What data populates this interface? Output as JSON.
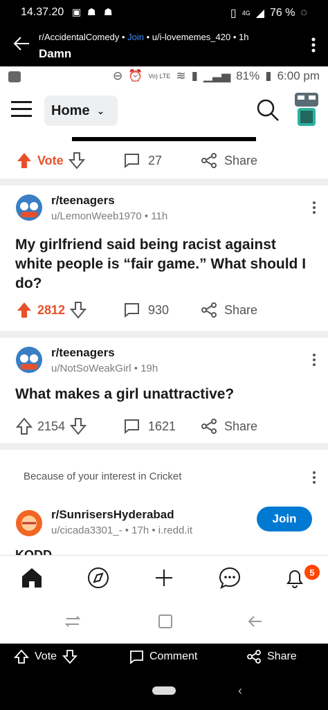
{
  "outer_status": {
    "time": "14.37.20",
    "network": "4G",
    "battery": "76 %"
  },
  "outer_header": {
    "subreddit": "r/AccidentalComedy",
    "join": "Join",
    "user": "u/i-lovememes_420",
    "age": "1h",
    "title": "Damn"
  },
  "inner_status": {
    "volte": "Vo) LTE",
    "battery": "81%",
    "time": "6:00 pm"
  },
  "topbar": {
    "home_label": "Home"
  },
  "first_actions": {
    "vote": "Vote",
    "comments": "27",
    "share": "Share"
  },
  "posts": [
    {
      "subreddit": "r/teenagers",
      "user": "u/LemonWeeb1970",
      "age": "11h",
      "title": "My girlfriend said being racist against white people is “fair game.” What should I do?",
      "votes": "2812",
      "comments": "930",
      "share": "Share",
      "upvoted": true
    },
    {
      "subreddit": "r/teenagers",
      "user": "u/NotSoWeakGirl",
      "age": "19h",
      "title": "What makes a girl unattractive?",
      "votes": "2154",
      "comments": "1621",
      "share": "Share",
      "upvoted": false
    }
  ],
  "recommendation": {
    "reason": "Because of your interest in Cricket",
    "subreddit": "r/SunrisersHyderabad",
    "user": "u/cicada3301_-",
    "age": "17h",
    "domain": "i.redd.it",
    "join": "Join",
    "title_peek": "KODD"
  },
  "bottom_nav": {
    "inbox_badge": "5"
  },
  "outer_bottom": {
    "vote": "Vote",
    "comment": "Comment",
    "share": "Share"
  },
  "colors": {
    "orangered": "#e8502a",
    "blue": "#0079d3",
    "gray_bg": "#edeff1"
  }
}
